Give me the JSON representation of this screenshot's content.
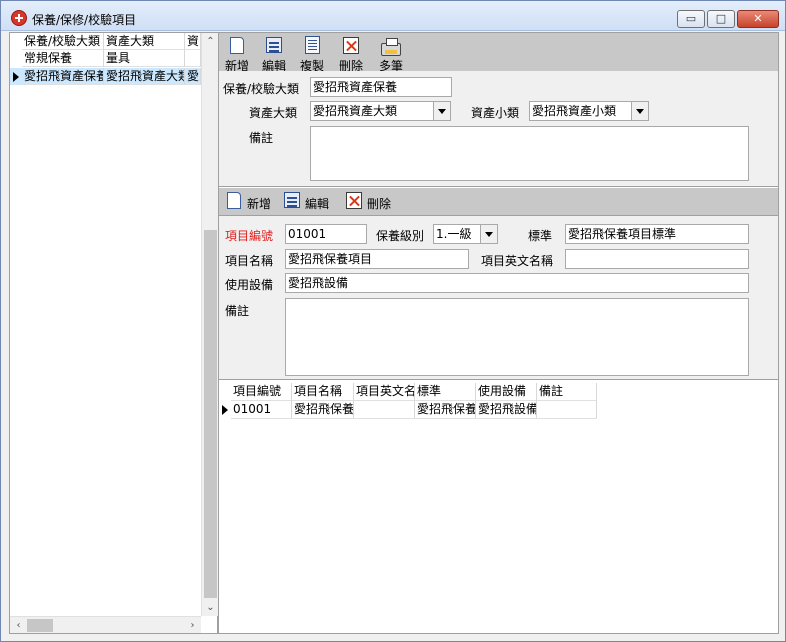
{
  "window": {
    "title": "保養/保修/校驗項目",
    "minimize": "▭",
    "maximize": "□",
    "close": "✕"
  },
  "left_grid": {
    "columns": [
      "保養/校驗大類",
      "資產大類",
      "資"
    ],
    "rows": [
      [
        "常規保養",
        "量具",
        ""
      ],
      [
        "愛招飛資產保養",
        "愛招飛資產大類",
        "愛"
      ]
    ],
    "selected_row": 1
  },
  "toolbar_main": {
    "add": "新增",
    "edit": "編輯",
    "copy": "複製",
    "delete": "刪除",
    "multi": "多筆"
  },
  "category_form": {
    "category_label": "保養/校驗大類",
    "category_value": "愛招飛資產保養",
    "asset_major_label": "資產大類",
    "asset_major_value": "愛招飛資產大類",
    "asset_minor_label": "資產小類",
    "asset_minor_value": "愛招飛資產小類",
    "remark_label": "備註",
    "remark_value": ""
  },
  "toolbar_items": {
    "add": "新增",
    "edit": "編輯",
    "delete": "刪除"
  },
  "item_form": {
    "code_label": "項目編號",
    "code_value": "01001",
    "level_label": "保養級別",
    "level_value": "1.一級",
    "standard_label": "標準",
    "standard_value": "愛招飛保養項目標準",
    "name_label": "項目名稱",
    "name_value": "愛招飛保養項目",
    "en_name_label": "項目英文名稱",
    "en_name_value": "",
    "equipment_label": "使用設備",
    "equipment_value": "愛招飛設備",
    "remark_label": "備註",
    "remark_value": ""
  },
  "detail_grid": {
    "columns": [
      "項目編號",
      "項目名稱",
      "項目英文名",
      "標準",
      "使用設備",
      "備註"
    ],
    "rows": [
      [
        "01001",
        "愛招飛保養",
        "",
        "愛招飛保養",
        "愛招飛設備",
        ""
      ]
    ]
  }
}
